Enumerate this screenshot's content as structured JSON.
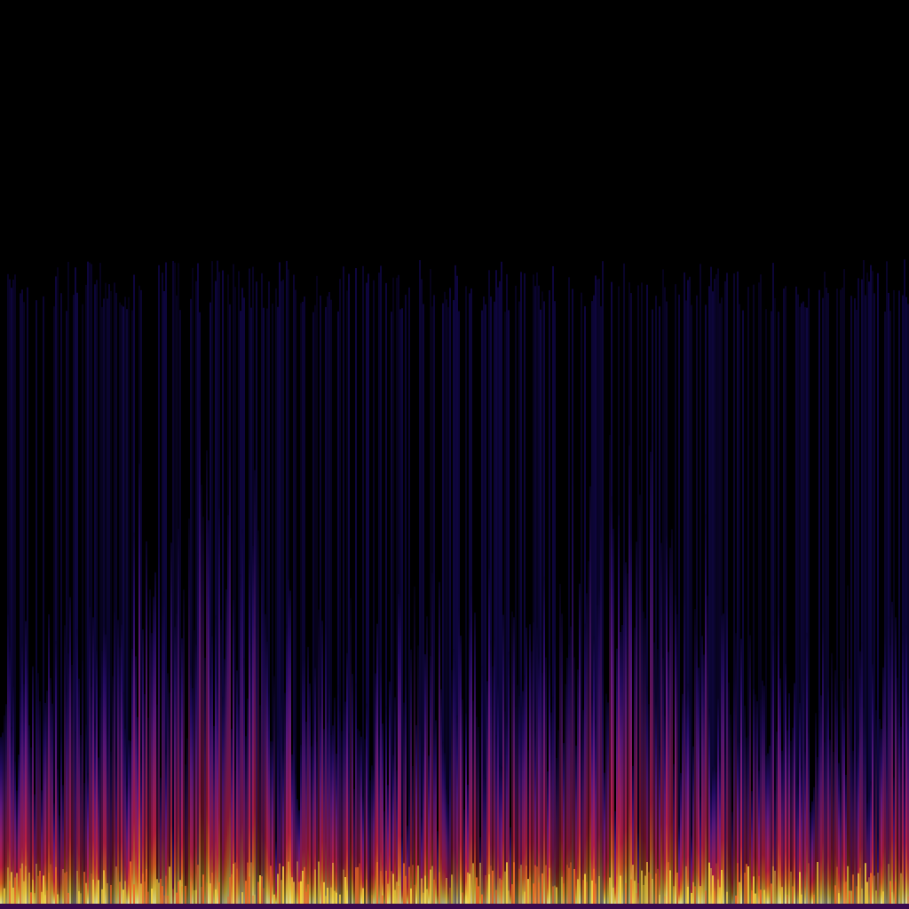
{
  "image": {
    "kind": "spectrogram",
    "colormap": "inferno",
    "background_color": "#000000",
    "palette": [
      "#000004",
      "#1b0c41",
      "#4a0c6b",
      "#781c6d",
      "#a52c60",
      "#cf4446",
      "#ed6925",
      "#fb9b06",
      "#f7d13d",
      "#fcffa4"
    ]
  }
}
